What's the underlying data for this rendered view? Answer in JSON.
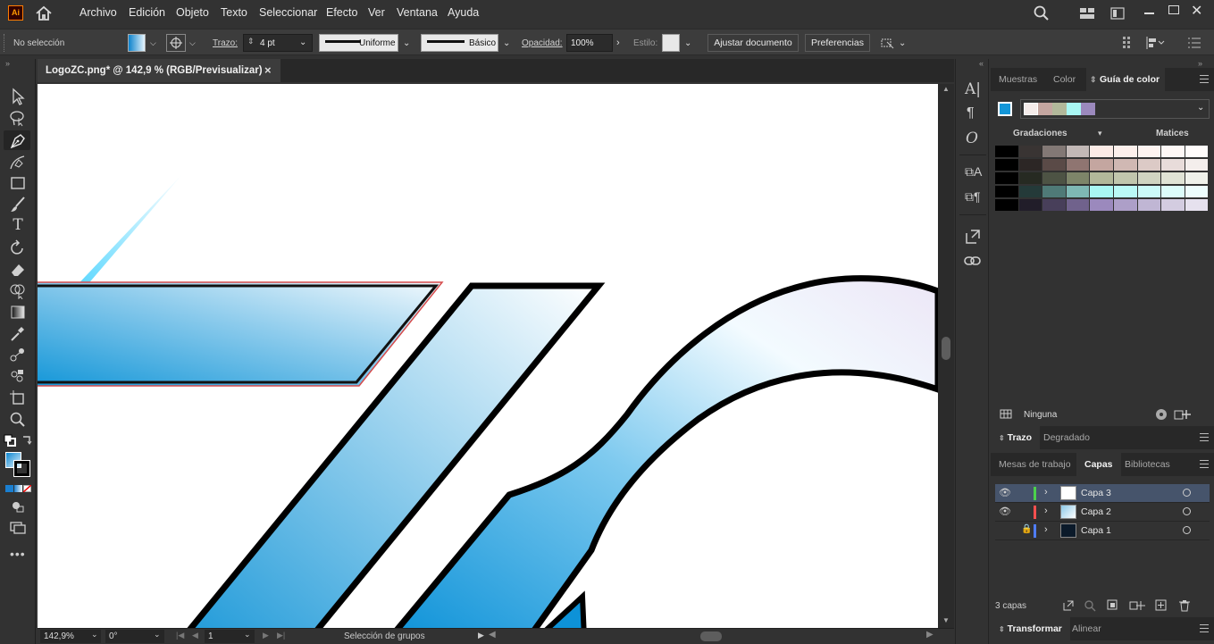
{
  "menubar": {
    "app_logo": "Ai",
    "items": [
      "Archivo",
      "Edición",
      "Objeto",
      "Texto",
      "Seleccionar",
      "Efecto",
      "Ver",
      "Ventana",
      "Ayuda"
    ]
  },
  "controlbar": {
    "selection_status": "No selección",
    "stroke_label": "Trazo:",
    "stroke_value": "4 pt",
    "profile_uniform": "Uniforme",
    "brush_basic": "Básico",
    "opacity_label": "Opacidad:",
    "opacity_value": "100%",
    "style_label": "Estilo:",
    "fit_document_button": "Ajustar documento",
    "preferences_button": "Preferencias"
  },
  "document": {
    "tab_title": "LogoZC.png* @ 142,9 % (RGB/Previsualizar)",
    "close_glyph": "×"
  },
  "statusbar": {
    "zoom": "142,9%",
    "rotation": "0°",
    "artboard": "1",
    "selection_info": "Selección de grupos"
  },
  "color_panel": {
    "tabs": [
      "Muestras",
      "Color",
      "Guía de color"
    ],
    "active_tab": "Guía de color",
    "gradations_label": "Gradaciones",
    "tints_label": "Matices",
    "none_label": "Ninguna",
    "harmony_colors": [
      "#f5ecea",
      "#c4a6a0",
      "#b2b89a",
      "#a9f7f3",
      "#9b89bd"
    ],
    "grid": [
      [
        "#000000",
        "#393433",
        "#827875",
        "#c2b8b6",
        "#fcebe6",
        "#fdf0ec",
        "#fef4f1",
        "#fef8f6",
        "#fffcfb"
      ],
      [
        "#000000",
        "#2c2625",
        "#5a4a47",
        "#8f7571",
        "#c4a6a0",
        "#d0b8b3",
        "#dccac6",
        "#e8dcda",
        "#f4eeec"
      ],
      [
        "#000000",
        "#262a22",
        "#4d5344",
        "#7d8569",
        "#b2b89a",
        "#c1c6ad",
        "#d0d4c1",
        "#e0e3d5",
        "#eff1ea"
      ],
      [
        "#000000",
        "#243a39",
        "#4f7a77",
        "#7eb8b4",
        "#a9f7f3",
        "#baf9f6",
        "#cbfaf8",
        "#dcfcfa",
        "#edfdfd"
      ],
      [
        "#000000",
        "#211d29",
        "#483f5a",
        "#70628c",
        "#9b89bd",
        "#ad9fc8",
        "#c0b6d4",
        "#d3cce0",
        "#e6e1ee"
      ]
    ]
  },
  "stroke_panel": {
    "tabs": [
      "Trazo",
      "Degradado"
    ]
  },
  "layers_panel": {
    "tabs": [
      "Mesas de trabajo",
      "Capas",
      "Bibliotecas"
    ],
    "active_tab": "Capas",
    "layers": [
      {
        "name": "Capa 3",
        "color": "#4cd14c",
        "visible": true,
        "locked": false,
        "selected": true
      },
      {
        "name": "Capa 2",
        "color": "#ff4f4f",
        "visible": true,
        "locked": false,
        "selected": false
      },
      {
        "name": "Capa 1",
        "color": "#4f7dff",
        "visible": false,
        "locked": true,
        "selected": false
      }
    ],
    "count_label": "3 capas"
  },
  "transform_panel": {
    "tabs": [
      "Transformar",
      "Alinear"
    ]
  },
  "colors": {
    "accent_blue": "#1396d8",
    "selected_row": "#46546b"
  }
}
